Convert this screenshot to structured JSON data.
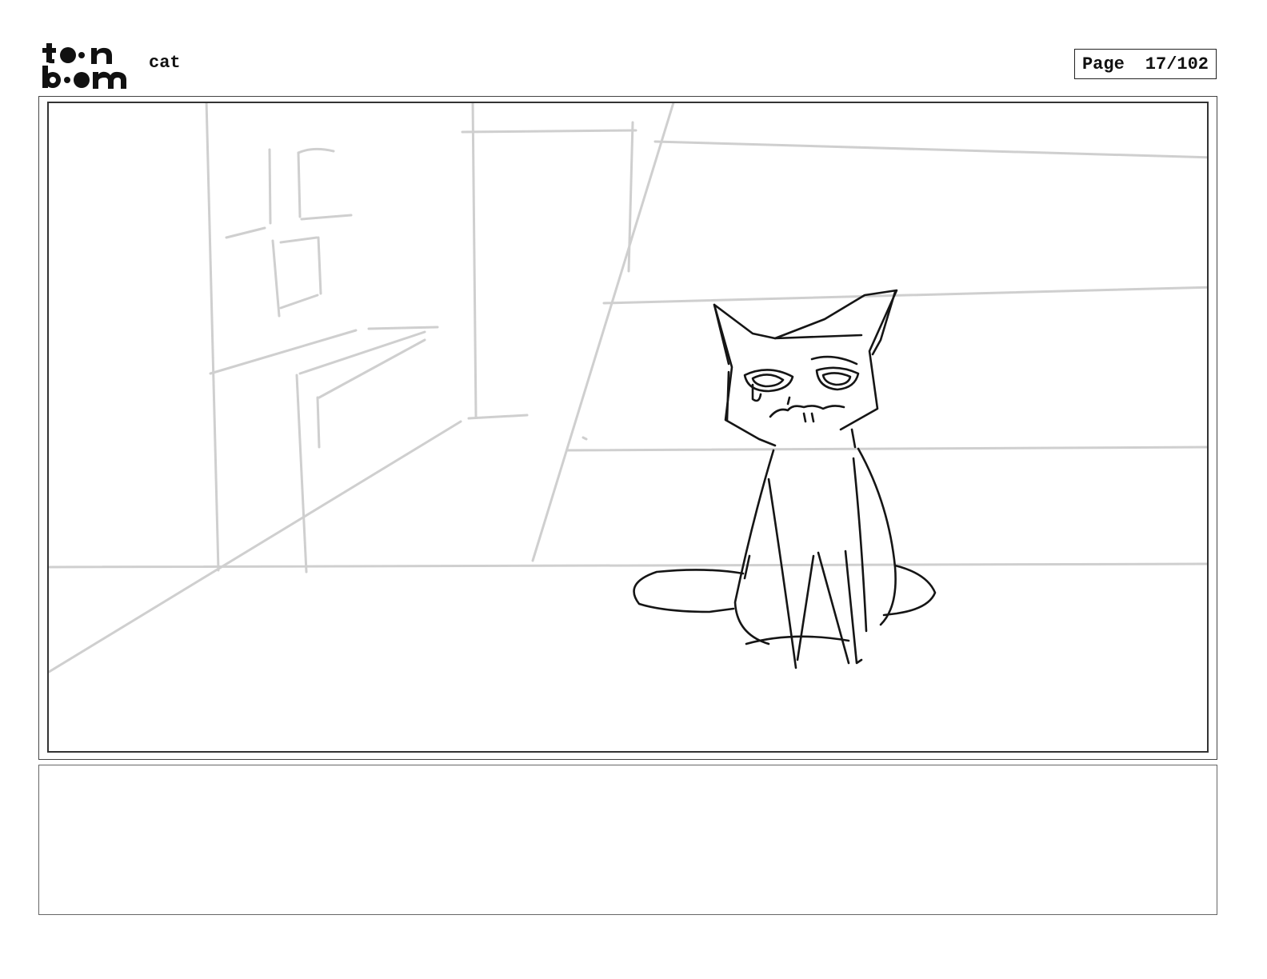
{
  "header": {
    "logo_text": "toonboom",
    "title": "cat",
    "page_label": "Page",
    "page_number": "17/102"
  },
  "panel": {
    "drawing": "storyboard-sketch-cat"
  },
  "notes": {
    "text": ""
  }
}
